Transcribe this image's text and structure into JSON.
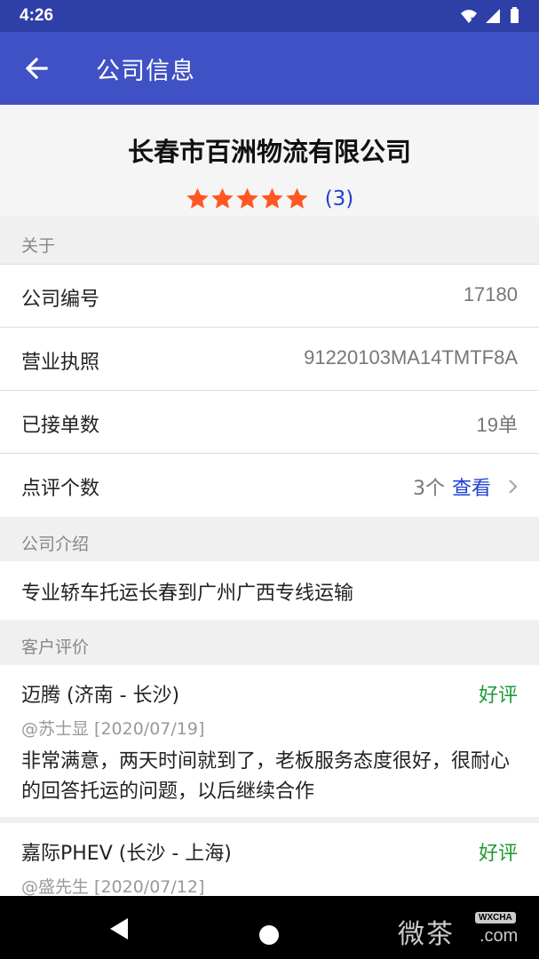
{
  "status_bar": {
    "time": "4:26"
  },
  "app_bar": {
    "title": "公司信息"
  },
  "company": {
    "name": "长春市百洲物流有限公司",
    "rating": {
      "stars": 5,
      "max": 5,
      "count_label": "(3)"
    }
  },
  "sections": {
    "about": "关于",
    "intro": "公司介绍",
    "reviews": "客户评价"
  },
  "info_rows": [
    {
      "label": "公司编号",
      "value": "17180"
    },
    {
      "label": "营业执照",
      "value": "91220103MA14TMTF8A"
    },
    {
      "label": "已接单数",
      "value": "19单"
    },
    {
      "label": "点评个数",
      "value": "3个",
      "link": "查看"
    }
  ],
  "intro": {
    "text": "专业轿车托运长春到广州广西专线运输"
  },
  "reviews": [
    {
      "title": "迈腾 (济南 - 长沙)",
      "tag": "好评",
      "meta": "@苏士显 [2020/07/19]",
      "body": "非常满意，两天时间就到了，老板服务态度很好，很耐心的回答托运的问题，以后继续合作"
    },
    {
      "title": "嘉际PHEV (长沙 - 上海)",
      "tag": "好评",
      "meta": "@盛先生 [2020/07/12]"
    }
  ],
  "watermark": {
    "text": "微茶",
    "badge": "WXCHA",
    "suffix": ".com"
  },
  "colors": {
    "status_bar": "#2f3fa8",
    "app_bar": "#3f51c4",
    "star": "#ff5722",
    "link": "#1e3fd6",
    "positive_tag": "#1e9a34"
  }
}
